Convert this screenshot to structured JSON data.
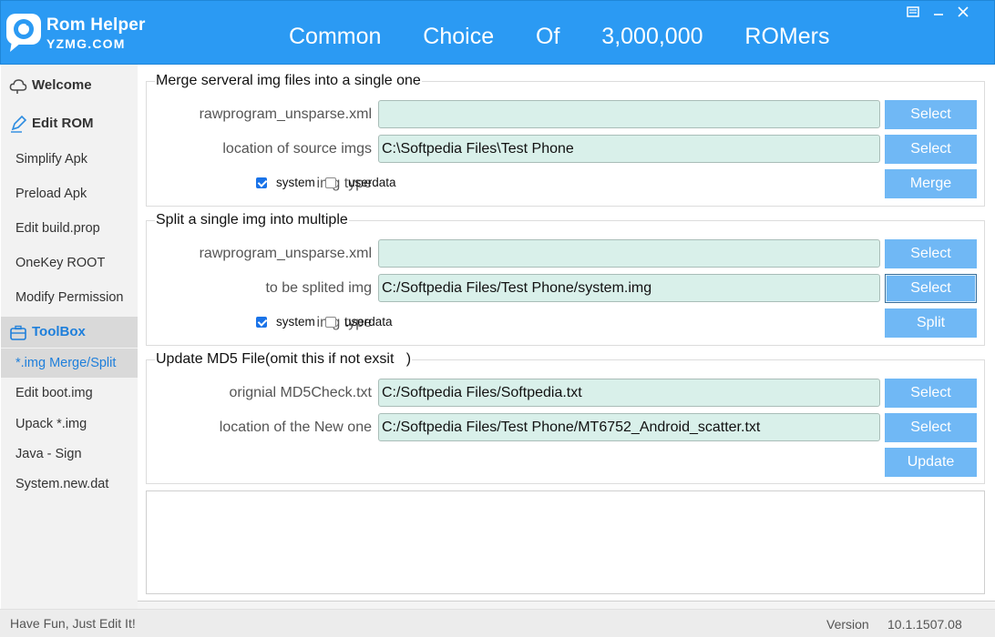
{
  "header": {
    "brand_name": "Rom Helper",
    "brand_sub": "YZMG.COM",
    "slogan": "Common  Choice  Of  3,000,000  ROMers"
  },
  "sidebar": {
    "welcome": "Welcome",
    "edit_rom": "Edit ROM",
    "edit_rom_items": [
      "Simplify Apk",
      "Preload Apk",
      "Edit build.prop",
      "OneKey ROOT",
      "Modify Permission"
    ],
    "toolbox": "ToolBox",
    "toolbox_items": [
      "*.img Merge/Split",
      "Edit boot.img",
      "Upack  *.img",
      "Java - Sign",
      "System.new.dat"
    ],
    "active_item": "*.img Merge/Split"
  },
  "merge": {
    "title": "Merge serveral img files into a single one",
    "rows": [
      {
        "label": "rawprogram_unsparse.xml",
        "value": "",
        "button": "Select"
      },
      {
        "label": "location of source imgs",
        "value": "C:\\Softpedia Files\\Test Phone",
        "button": "Select"
      }
    ],
    "img_type_label": "img type",
    "options": [
      {
        "label": "system",
        "checked": true
      },
      {
        "label": "userdata",
        "checked": false
      }
    ],
    "action": "Merge"
  },
  "split": {
    "title": "Split a single img into multiple",
    "rows": [
      {
        "label": "rawprogram_unsparse.xml",
        "value": "",
        "button": "Select"
      },
      {
        "label": "to be splited img",
        "value": "C:/Softpedia Files/Test Phone/system.img",
        "button": "Select"
      }
    ],
    "img_type_label": "img type",
    "options": [
      {
        "label": "system",
        "checked": true
      },
      {
        "label": "userdata",
        "checked": false
      }
    ],
    "action": "Split"
  },
  "md5": {
    "title": "Update MD5 File(omit this if not exsit   )",
    "rows": [
      {
        "label": "orignial MD5Check.txt",
        "value": "C:/Softpedia Files/Softpedia.txt",
        "button": "Select"
      },
      {
        "label": "location of the New one",
        "value": "C:/Softpedia Files/Test Phone/MT6752_Android_scatter.txt",
        "button": "Select"
      }
    ],
    "action": "Update"
  },
  "status": {
    "left": "Have Fun, Just Edit It!",
    "version_label": "Version",
    "version": "10.1.1507.08"
  },
  "colors": {
    "header": "#2b9af3",
    "button": "#70b8f5",
    "field": "#d9f0ea",
    "sidebar": "#f2f2f2",
    "accent": "#1e7fdb",
    "checkbox": "#1a73e8"
  },
  "icons": {
    "logo": "chat-bubble-logo",
    "welcome": "cloud-icon",
    "edit_rom": "pencil-icon",
    "toolbox": "toolbox-icon",
    "window_controls": [
      "restore-icon",
      "minimize-icon",
      "close-icon"
    ]
  }
}
